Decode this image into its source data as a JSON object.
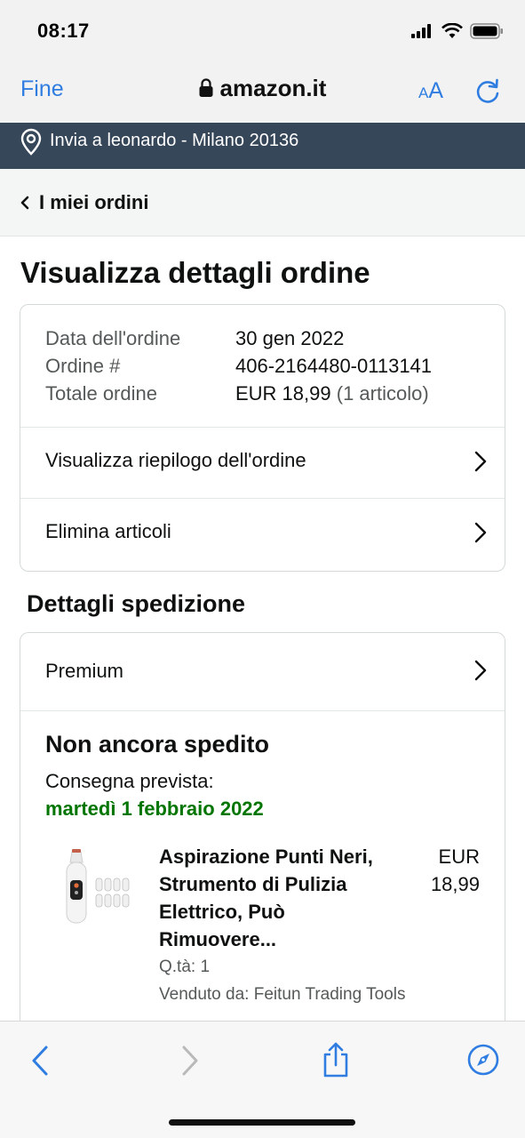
{
  "status_bar": {
    "time": "08:17"
  },
  "browser": {
    "done_label": "Fine",
    "url": "amazon.it",
    "text_size_small": "A",
    "text_size_big": "A"
  },
  "delivery_bar": {
    "text": "Invia a leonardo - Milano 20136"
  },
  "breadcrumb": {
    "label": "I miei ordini"
  },
  "page": {
    "title": "Visualizza dettagli ordine"
  },
  "order": {
    "rows": [
      {
        "label": "Data dell'ordine",
        "value": "30 gen 2022",
        "extra": ""
      },
      {
        "label": "Ordine #",
        "value": "406-2164480-0113141",
        "extra": ""
      },
      {
        "label": "Totale ordine",
        "value": "EUR 18,99",
        "extra": "(1 articolo)"
      }
    ],
    "links": [
      {
        "label": "Visualizza riepilogo dell'ordine"
      },
      {
        "label": "Elimina articoli"
      }
    ]
  },
  "shipping": {
    "section_title": "Dettagli spedizione",
    "premium_label": "Premium",
    "status": "Non ancora spedito",
    "delivery_label": "Consegna prevista:",
    "delivery_date": "martedì 1 febbraio 2022",
    "item": {
      "title": "Aspirazione Punti Neri, Strumento di Pulizia Elettrico, Può Rimuovere...",
      "price_currency": "EUR",
      "price_amount": "18,99",
      "quantity": "Q.tà: 1",
      "seller": "Venduto da: Feitun Trading Tools"
    }
  },
  "colors": {
    "accent": "#2f7de1",
    "header_dark": "#37475a",
    "delivery_green": "#007600"
  },
  "icons": [
    "signal-icon",
    "wifi-icon",
    "battery-icon",
    "lock-icon",
    "reload-icon",
    "location-pin-icon",
    "chevron-left-icon",
    "chevron-right-icon",
    "back-icon",
    "forward-icon",
    "share-icon",
    "compass-icon"
  ]
}
